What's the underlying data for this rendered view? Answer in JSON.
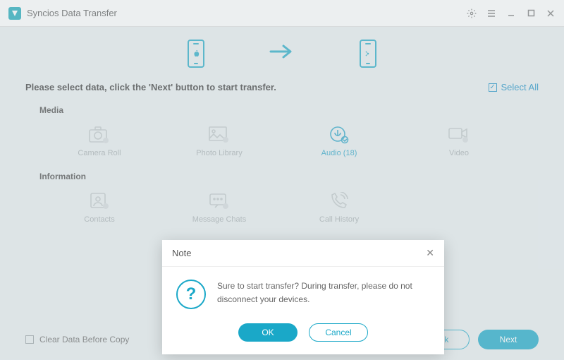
{
  "app": {
    "title": "Syncios Data Transfer"
  },
  "instruction": "Please select data, click the 'Next' button to start transfer.",
  "selectAll": {
    "label": "Select All",
    "checked": true
  },
  "sections": {
    "media": {
      "label": "Media",
      "items": [
        {
          "label": "Camera Roll"
        },
        {
          "label": "Photo Library"
        },
        {
          "label": "Audio (18)",
          "selected": true
        },
        {
          "label": "Video"
        }
      ]
    },
    "information": {
      "label": "Information",
      "items": [
        {
          "label": "Contacts"
        },
        {
          "label": "Message Chats"
        },
        {
          "label": "Call History"
        }
      ]
    }
  },
  "footer": {
    "clearData": "Clear Data Before Copy",
    "back": "Back",
    "next": "Next"
  },
  "dialog": {
    "title": "Note",
    "message": "Sure to start transfer? During transfer, please do not disconnect your devices.",
    "ok": "OK",
    "cancel": "Cancel"
  }
}
